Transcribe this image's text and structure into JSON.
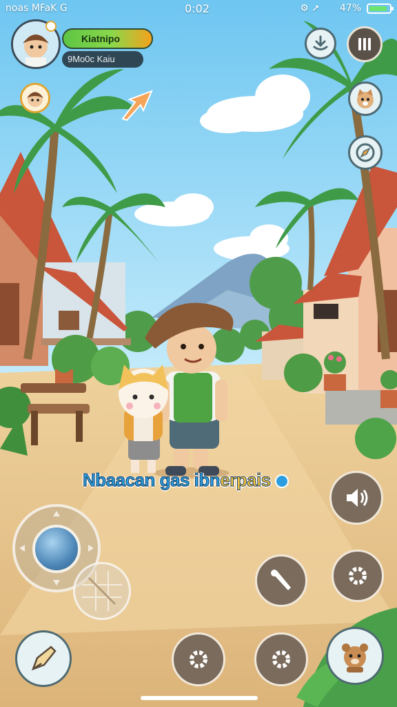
{
  "status_bar": {
    "left_text": "noas MFaK G",
    "time": "0:02",
    "battery_text": "47%",
    "battery_level": 0.9
  },
  "player": {
    "name": "Kiatnipo",
    "subtitle": "9Mo0c Kaiu"
  },
  "hint_text_before": "Nbaacan gas ibn",
  "hint_text_highlight": "erpais",
  "hint_icon": "chat-bubble-icon",
  "top_right_buttons": [
    "download-icon",
    "pause-icon",
    "pet-portrait-icon",
    "compass-icon"
  ],
  "right_buttons": [
    "speaker-icon",
    "settings-gear-icon",
    "tool-icon"
  ],
  "bottom_buttons": [
    "attack-icon",
    "settings-gear-icon",
    "settings-gear-icon",
    "pet-portrait-icon"
  ],
  "colors": {
    "sky": "#8fd3f4",
    "ground": "#e9c892",
    "accent_green": "#5ec545",
    "accent_orange": "#f4a21c",
    "hint_blue": "#2b9ee0",
    "hint_yellow": "#f5c542"
  }
}
